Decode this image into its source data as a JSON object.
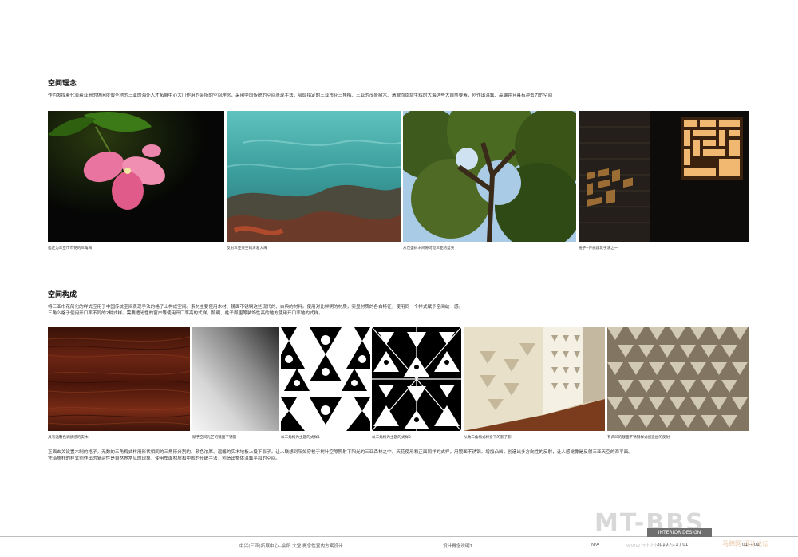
{
  "section1": {
    "title": "空间理念",
    "description": "作为发挥着代表着亚洲的休闲度假圣地的三亚的海外人才拓展中心大门作用的会所的空间理念，采用中国传统的空间表现手法，吸取指定的三亚市花三角梅、三亚的茂盛树木、清澈而熠熠生辉的大海这些大自然要素，创作出温馨、高端并且具有冲击力的空间",
    "images": [
      {
        "icon": "bougainvillea-photo",
        "caption": "指定为三亚市市花的三角梅"
      },
      {
        "icon": "sea-water-photo",
        "caption": "反射三亚天空的清澈大海"
      },
      {
        "icon": "tree-canopy-photo",
        "caption": "从茂盛树木间隙可见三亚的蓝天"
      },
      {
        "icon": "lattice-window-photo",
        "caption": "格子--传统建筑手法之一"
      }
    ]
  },
  "section2": {
    "title": "空间构成",
    "description_line1": "将三亚市花简化的样式应用于中国传统空间表现手法的格子上构成空间。素材主要使用木材、镜面不锈钢这些现代的、古典的材料。使用对比鲜明的材质，突显材质的各自特征，使用同一个样式赋予空间统一感。",
    "description_line2": "三角么格子使用开口率不同的2种式样。需要透光性的窗户等使用开口率高的式样，照明、柱子周围等装饰性高的地方使用开口率地的式样。",
    "images": [
      {
        "icon": "wood-texture",
        "caption": "具有温馨色调质感的实木"
      },
      {
        "icon": "stainless-steel-texture",
        "caption": "赋予空间光芒的镜面不锈钢"
      },
      {
        "icon": "triangle-pattern-1",
        "caption": "以三角梅为主题的式样1"
      },
      {
        "icon": "triangle-pattern-2",
        "caption": "以三角梅为主题的式样2"
      },
      {
        "icon": "shadow-room-photo",
        "caption": "从数三角梅式样投下的影子影"
      },
      {
        "icon": "lattice-wall-photo",
        "caption": "有凸凹的镜面不锈钢样式创造出的反射"
      }
    ],
    "body_line1": "正面玄关设置木制的格子。无数的三角梅式样用形状相同的三角形分割的。颜色浓厚、温馨的实木地板上投下影子。让人联想到阳如穿梭于树叶空隙照射下阳光的三亚森林之中。天花使用和正面同样的式样，用镜面不锈钢。增加凸凹，创造出多方向性的反射，让人感觉像是反射三亚天空的海平面。",
    "body_line2": "凭借质朴的样式创作出的复杂性是自然界常见的现象，使用塑面材质和中国的传统手法，创造出整体温馨平和的空间。"
  },
  "footer": {
    "project": "中兴(三亚)拓展中心--会所 大堂 概念性室内方案设计",
    "sheet": "设计概念说明1",
    "scale": "N/A",
    "date": "2010 / 11 / 01",
    "page": "01 -- 01",
    "badge": "INTERIOR DESIGN",
    "watermark": "MT-BBS",
    "watermark_sub": "马蹄网·设计论坛",
    "watermark_url": "www.mt-bbs.com"
  },
  "colors": {
    "pink": "#e8749f",
    "sea": "#48a8a6",
    "wood": "#5a1e10",
    "pattern_bg": "#ffffff",
    "pattern_fg": "#000000"
  }
}
